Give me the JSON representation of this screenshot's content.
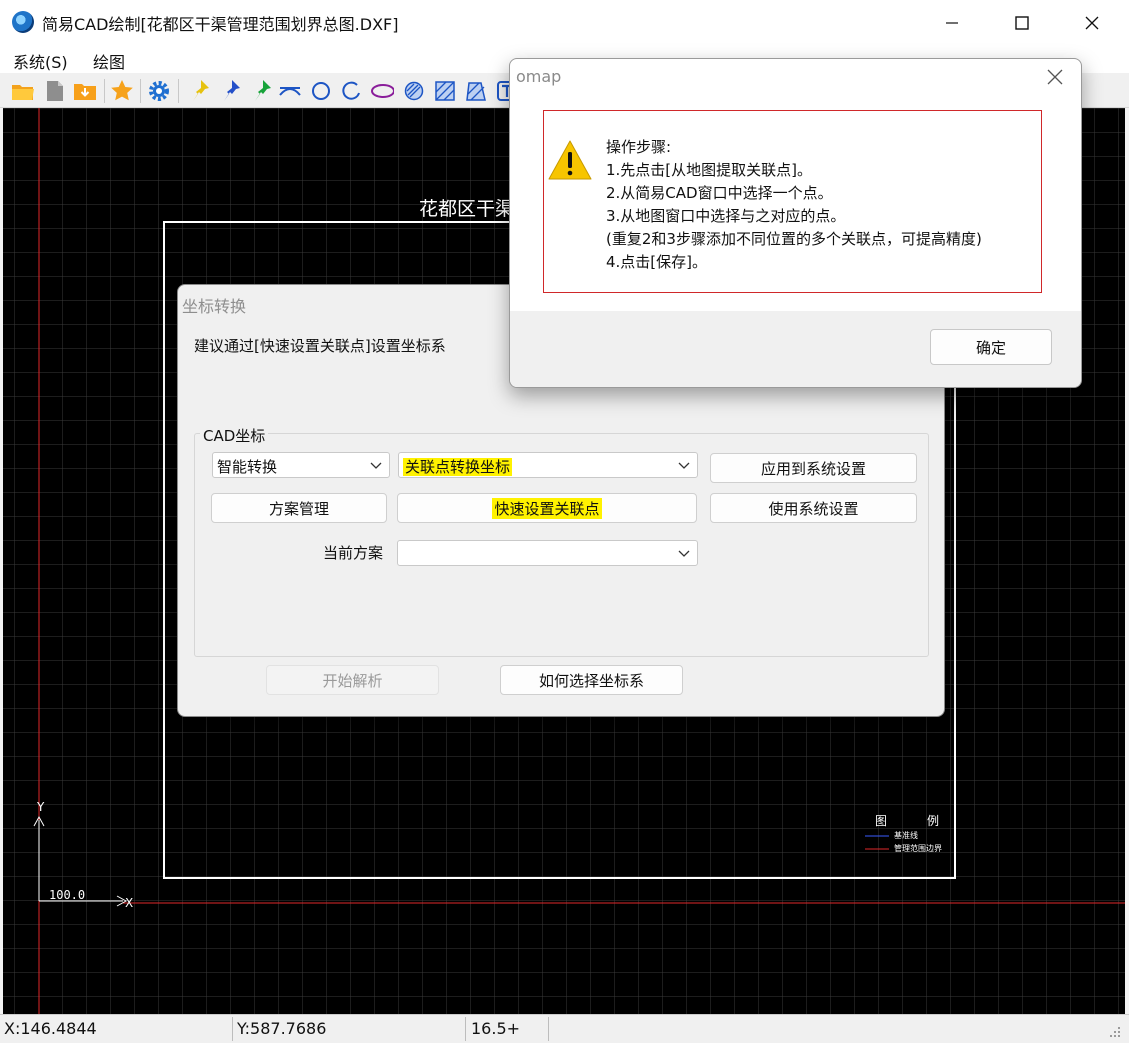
{
  "window": {
    "title": "简易CAD绘制[花都区干渠管理范围划界总图.DXF]"
  },
  "menu": {
    "items": [
      "系统(S)",
      "绘图"
    ]
  },
  "toolbar": {
    "icons": [
      "open-folder-icon",
      "new-file-icon",
      "save-icon",
      "favorite-star-icon",
      "settings-gear-icon",
      "yellow-pin-icon",
      "blue-pin-icon",
      "green-pin-icon",
      "arc-icon",
      "circle-icon",
      "partial-circle-icon",
      "ellipse-icon",
      "hatch-circle-icon",
      "hatch-square-icon",
      "hatch-polygon-icon",
      "text-icon"
    ]
  },
  "canvas": {
    "drawing_title": "花都区干渠",
    "axis_y_label": "Y",
    "axis_x_label": "X",
    "axis_value": "100.0",
    "legend": {
      "title_left": "图",
      "title_right": "例",
      "items": [
        "基准线",
        "管理范围边界"
      ]
    }
  },
  "coord_dialog": {
    "title": "坐标转换",
    "hint": "建议通过[快速设置关联点]设置坐标系",
    "group_label": "CAD坐标",
    "mode_combo": "智能转换",
    "method_combo": "关联点转换坐标",
    "apply_button": "应用到系统设置",
    "plan_button": "方案管理",
    "quick_button": "快速设置关联点",
    "use_system_button": "使用系统设置",
    "current_plan_label": "当前方案",
    "current_plan_value": "",
    "start_button": "开始解析",
    "howto_button": "如何选择坐标系"
  },
  "omap": {
    "title": "omap",
    "lines": [
      "操作步骤:",
      "1.先点击[从地图提取关联点]。",
      "2.从简易CAD窗口中选择一个点。",
      "3.从地图窗口中选择与之对应的点。",
      "(重复2和3步骤添加不同位置的多个关联点，可提高精度)",
      "4.点击[保存]。"
    ],
    "ok_button": "确定"
  },
  "status": {
    "x": "X:146.4844",
    "y": "Y:587.7686",
    "zoom": "16.5+"
  }
}
